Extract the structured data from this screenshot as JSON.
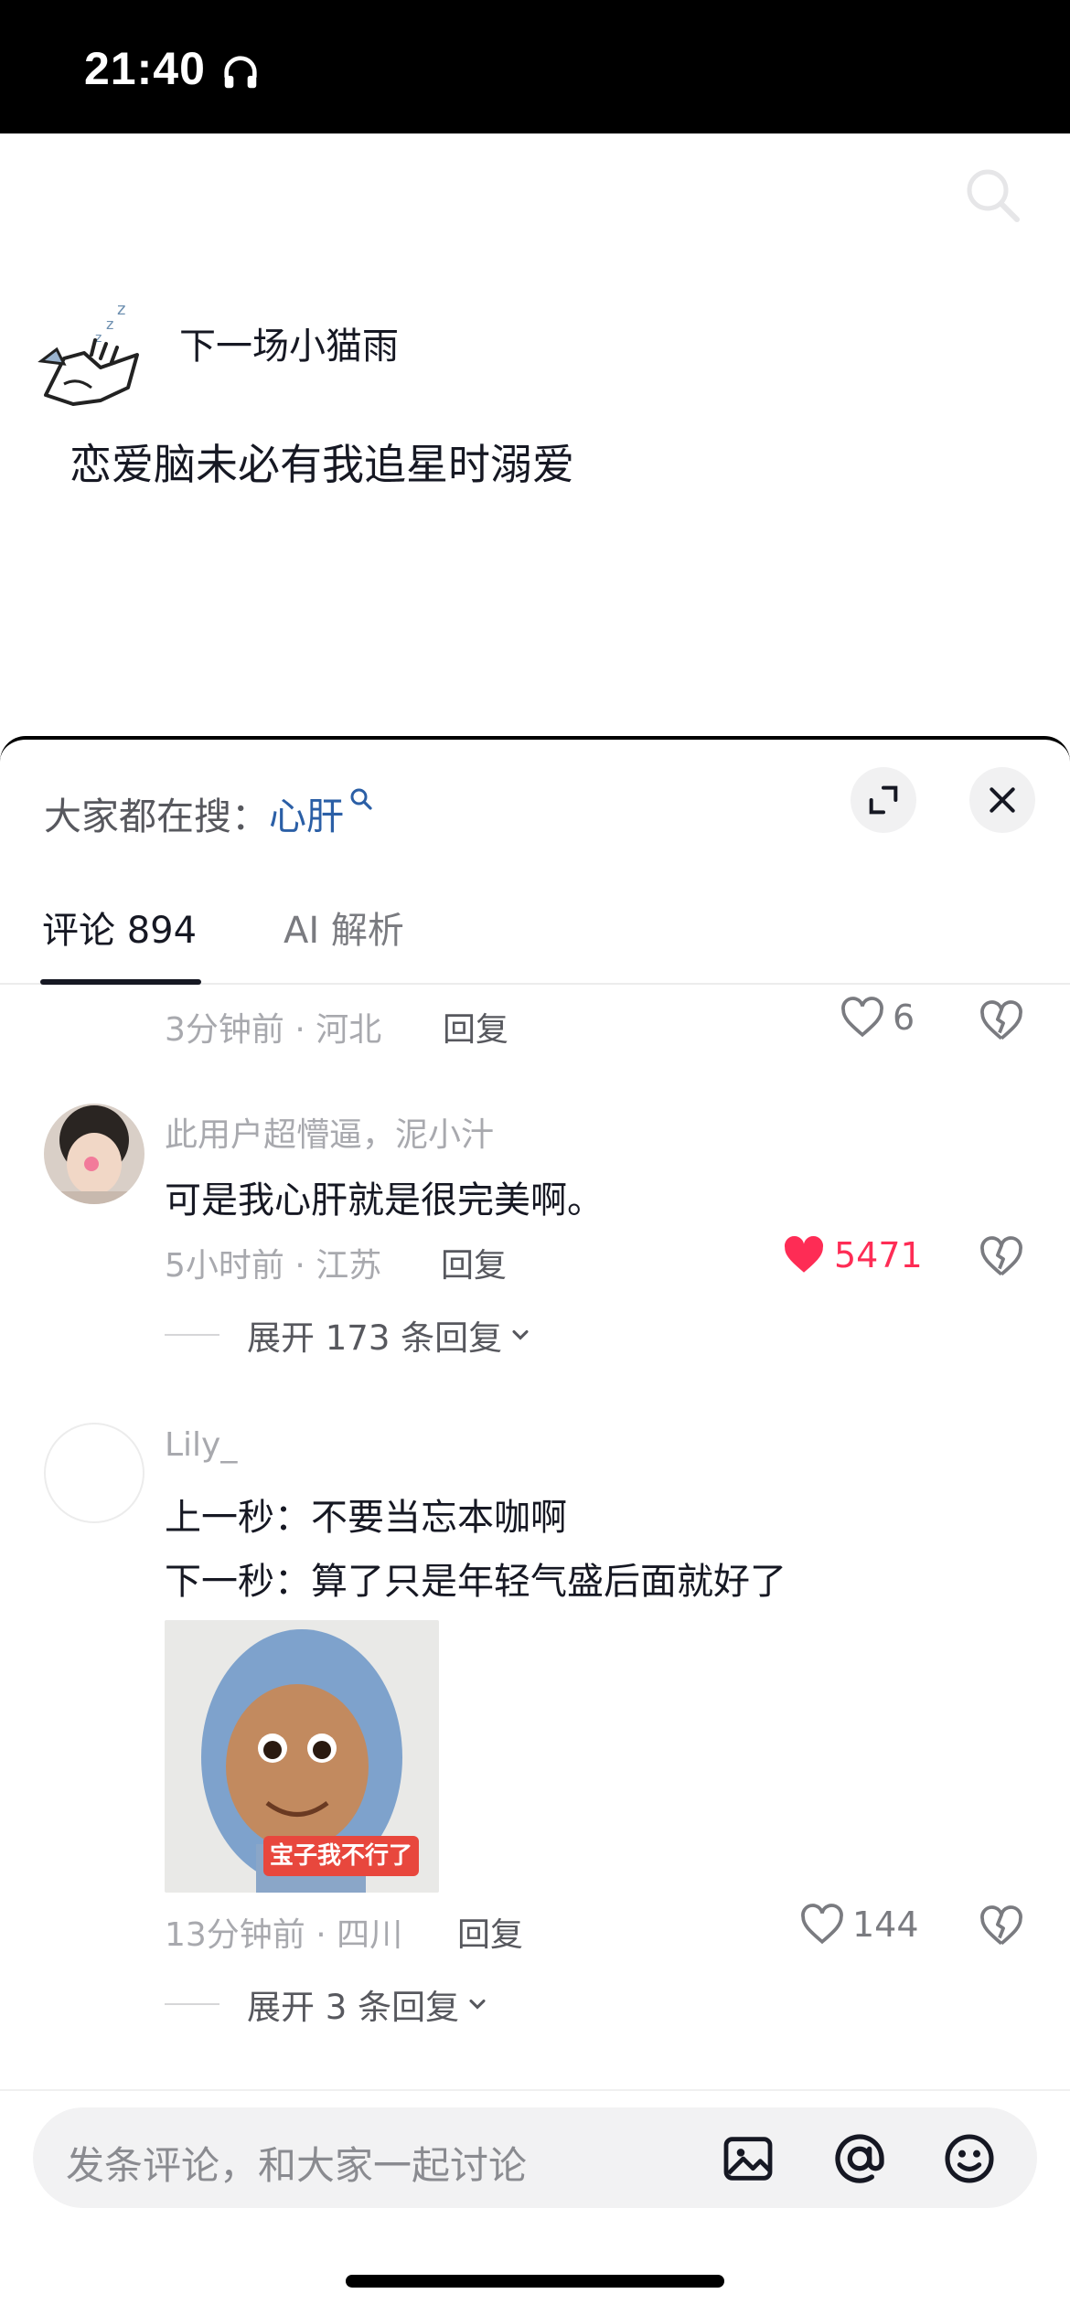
{
  "status_bar": {
    "time": "21:40",
    "headphone_icon": "headphone-icon"
  },
  "post": {
    "username": "下一场小猫雨",
    "text": "恋爱脑未必有我追星时溺爱"
  },
  "sheet": {
    "trending_prefix": "大家都在搜：",
    "trending_keyword": "心肝"
  },
  "tabs": {
    "comments": "评论 894",
    "ai": "AI 解析"
  },
  "comments": [
    {
      "meta": "3分钟前 · 河北",
      "reply": "回复",
      "likes": "6"
    },
    {
      "user": "此用户超懵逼，泥小汁",
      "text": "可是我心肝就是很完美啊。",
      "meta": "5小时前 · 江苏",
      "reply": "回复",
      "likes": "5471",
      "liked": true,
      "expand": "展开 173 条回复"
    },
    {
      "user": "Lily_",
      "lines": [
        "上一秒：不要当忘本咖啊",
        "下一秒：算了只是年轻气盛后面就好了"
      ],
      "sticker_caption": "宝子我不行了",
      "meta": "13分钟前 · 四川",
      "reply": "回复",
      "likes": "144",
      "expand": "展开 3 条回复"
    }
  ],
  "input": {
    "placeholder": "发条评论，和大家一起讨论"
  },
  "colors": {
    "accent_like": "#fe2c55",
    "link_blue": "#2b5fa6"
  }
}
